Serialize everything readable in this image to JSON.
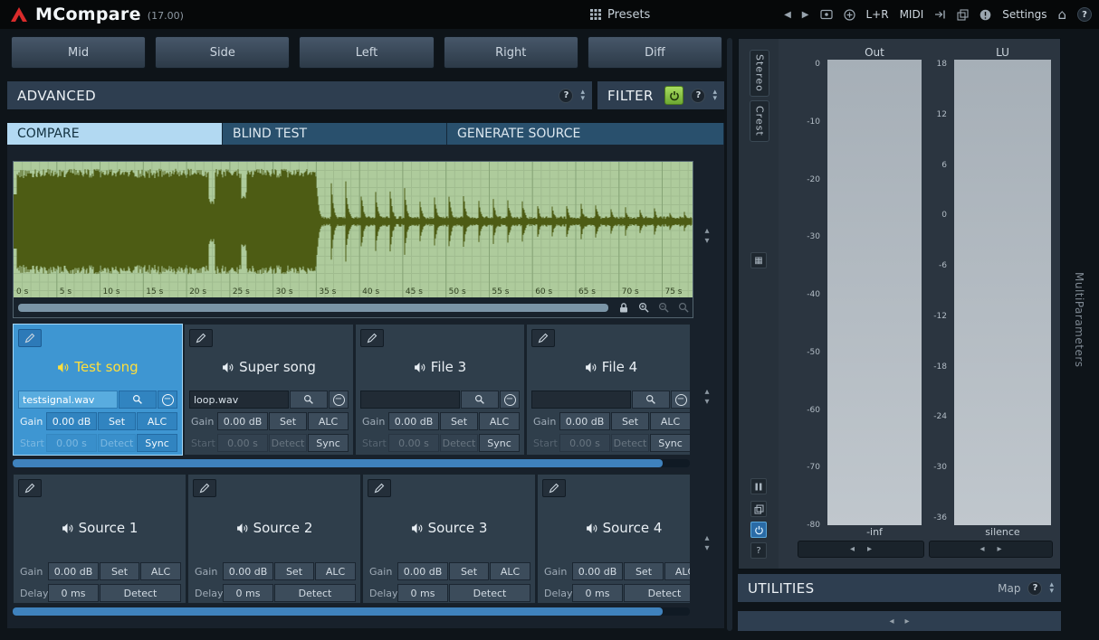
{
  "colors": {
    "accent_blue": "#3e96d2",
    "selection_yellow": "#ffdf3c",
    "filter_green": "#8cc640",
    "waveform_bg": "#aecb9c",
    "waveform_ink": "#4d5c14",
    "scrollbar_blue": "#3f82bd"
  },
  "icons": {
    "prev": "◀",
    "next": "▶",
    "home": "⌂",
    "question": "?",
    "collapse_up": "▴",
    "collapse_down": "▾",
    "step_left": "◂",
    "step_right": "▸",
    "minus": "−",
    "grid_small": "▦"
  },
  "titlebar": {
    "title": "MCompare",
    "version": "(17.00)",
    "presets_label": "Presets",
    "lr_label": "L+R",
    "midi_label": "MIDI",
    "settings_label": "Settings"
  },
  "channels": [
    "Mid",
    "Side",
    "Left",
    "Right",
    "Diff"
  ],
  "sections": {
    "advanced": "ADVANCED",
    "filter": "FILTER",
    "utilities": "UTILITIES",
    "map": "Map"
  },
  "tabs": [
    "COMPARE",
    "BLIND TEST",
    "GENERATE SOURCE"
  ],
  "active_tab": 0,
  "waveform": {
    "time_labels": [
      "0 s",
      "5 s",
      "10 s",
      "15 s",
      "20 s",
      "25 s",
      "30 s",
      "35 s",
      "40 s",
      "45 s",
      "50 s",
      "55 s",
      "60 s",
      "65 s",
      "70 s",
      "75 s"
    ]
  },
  "files": [
    {
      "selected": true,
      "name": "Test song",
      "file": "testsignal.wav",
      "gain_label": "Gain",
      "gain": "0.00 dB",
      "set_label": "Set",
      "alc_label": "ALC",
      "start_label": "Start",
      "start": "0.00 s",
      "detect_label": "Detect",
      "sync_label": "Sync"
    },
    {
      "selected": false,
      "name": "Super song",
      "file": "loop.wav",
      "gain_label": "Gain",
      "gain": "0.00 dB",
      "set_label": "Set",
      "alc_label": "ALC",
      "start_label": "Start",
      "start": "0.00 s",
      "detect_label": "Detect",
      "sync_label": "Sync"
    },
    {
      "selected": false,
      "name": "File 3",
      "file": "",
      "gain_label": "Gain",
      "gain": "0.00 dB",
      "set_label": "Set",
      "alc_label": "ALC",
      "start_label": "Start",
      "start": "0.00 s",
      "detect_label": "Detect",
      "sync_label": "Sync"
    },
    {
      "selected": false,
      "name": "File 4",
      "file": "",
      "gain_label": "Gain",
      "gain": "0.00 dB",
      "set_label": "Set",
      "alc_label": "ALC",
      "start_label": "Start",
      "start": "0.00 s",
      "detect_label": "Detect",
      "sync_label": "Sync"
    }
  ],
  "sources": [
    {
      "name": "Source 1",
      "gain_label": "Gain",
      "gain": "0.00 dB",
      "set_label": "Set",
      "alc_label": "ALC",
      "delay_label": "Delay",
      "delay": "0 ms",
      "detect_label": "Detect"
    },
    {
      "name": "Source 2",
      "gain_label": "Gain",
      "gain": "0.00 dB",
      "set_label": "Set",
      "alc_label": "ALC",
      "delay_label": "Delay",
      "delay": "0 ms",
      "detect_label": "Detect"
    },
    {
      "name": "Source 3",
      "gain_label": "Gain",
      "gain": "0.00 dB",
      "set_label": "Set",
      "alc_label": "ALC",
      "delay_label": "Delay",
      "delay": "0 ms",
      "detect_label": "Detect"
    },
    {
      "name": "Source 4",
      "gain_label": "Gain",
      "gain": "0.00 dB",
      "set_label": "Set",
      "alc_label": "ALC",
      "delay_label": "Delay",
      "delay": "0 ms",
      "detect_label": "Detect"
    }
  ],
  "meters": {
    "out_label": "Out",
    "lu_label": "LU",
    "stereo_tab": "Stereo",
    "crest_tab": "Crest",
    "out_scale": [
      "0",
      "-10",
      "-20",
      "-30",
      "-40",
      "-50",
      "-60",
      "-70",
      "-80"
    ],
    "lu_scale": [
      "18",
      "12",
      "6",
      "0",
      "-6",
      "-12",
      "-18",
      "-24",
      "-30",
      "-36"
    ],
    "out_readout": "-inf",
    "lu_readout": "silence"
  },
  "right_edge_label": "MultiParameters"
}
